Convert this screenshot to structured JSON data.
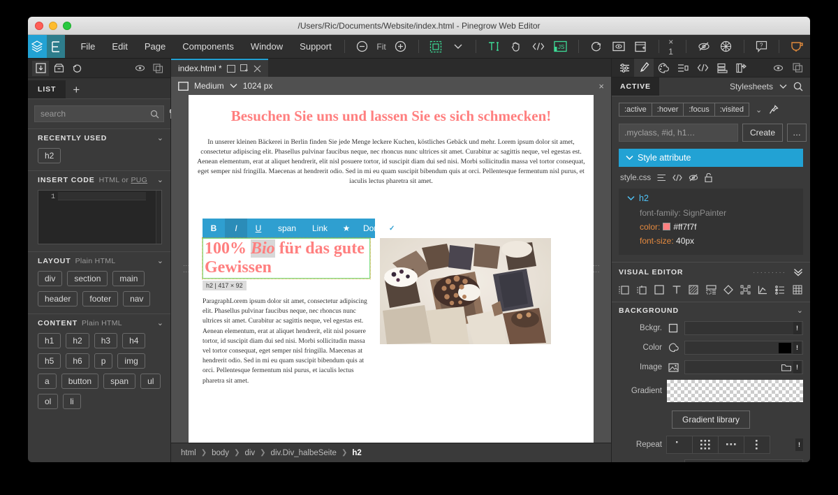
{
  "window": {
    "title": "/Users/Ric/Documents/Website/index.html - Pinegrow Web Editor"
  },
  "menubar": {
    "logo_left": "pinegrow-logo",
    "logo_right": "E",
    "items": [
      "File",
      "Edit",
      "Page",
      "Components",
      "Window",
      "Support"
    ],
    "zoom_fit_label": "Fit",
    "multiplier_label": "× 1"
  },
  "left_panel": {
    "panel_icons": [
      "insert-panel-icon",
      "library-icon",
      "undo-icon",
      "eye-icon",
      "duplicate-icon"
    ],
    "tab_label": "LIST",
    "add_tab_label": "+",
    "search": {
      "placeholder": "search",
      "value": ""
    },
    "sections": [
      {
        "title": "RECENTLY USED",
        "subtitle": "",
        "chips": [
          "h2"
        ]
      },
      {
        "title": "INSERT CODE",
        "subtitle": "HTML or ",
        "subtitle_link": "PUG",
        "code_line_number": "1"
      },
      {
        "title": "LAYOUT",
        "subtitle": "Plain HTML",
        "chips": [
          "div",
          "section",
          "main",
          "header",
          "footer",
          "nav"
        ]
      },
      {
        "title": "CONTENT",
        "subtitle": "Plain HTML",
        "chips": [
          "h1",
          "h2",
          "h3",
          "h4",
          "h5",
          "h6",
          "p",
          "img",
          "a",
          "button",
          "span",
          "ul",
          "ol",
          "li"
        ]
      }
    ]
  },
  "center": {
    "doc_tab": {
      "label": "index.html *",
      "icons": [
        "window-icon",
        "new-window-icon",
        "close-icon"
      ]
    },
    "canvas_bar": {
      "breakpoint_label": "Medium",
      "width_label": "1024 px",
      "close_label": "×"
    },
    "page": {
      "h1": "Besuchen Sie uns und lassen Sie es sich schmecken!",
      "intro": "In unserer kleinen Bäckerei in Berlin finden Sie jede Menge leckere Kuchen, köstliches Gebäck und mehr.  Lorem ipsum dolor sit amet, consectetur adipiscing elit. Phasellus pulvinar faucibus neque, nec rhoncus nunc ultrices sit amet. Curabitur ac sagittis neque, vel egestas est. Aenean elementum, erat at aliquet hendrerit, elit nisl posuere tortor, id suscipit diam dui sed nisi. Morbi sollicitudin massa vel tortor consequat, eget semper nisl fringilla. Maecenas at hendrerit odio. Sed in mi eu quam suscipit bibendum quis at orci. Pellentesque fermentum nisl purus, et iaculis lectus pharetra sit amet.",
      "edit_toolbar": {
        "bold": "B",
        "italic": "I",
        "underline": "U",
        "span": "span",
        "link": "Link",
        "star": "★",
        "done": "Done",
        "done_check": "✓"
      },
      "h2_part1": "100% ",
      "h2_em": "Bio",
      "h2_part2": " für das gute Gewissen",
      "h2_badge": "h2 | 417 × 92",
      "paragraph": "ParagraphLorem ipsum dolor sit amet, consectetur adipiscing elit. Phasellus pulvinar faucibus neque, nec rhoncus nunc ultrices sit amet. Curabitur ac sagittis neque, vel egestas est. Aenean elementum, erat at aliquet hendrerit, elit nisl posuere tortor, id suscipit diam dui sed nisi. Morbi sollicitudin massa vel tortor consequat, eget semper nisl fringilla. Maecenas at hendrerit odio. Sed in mi eu quam suscipit bibendum quis at orci. Pellentesque fermentum nisl purus, et iaculis lectus pharetra sit amet.",
      "image_alt": "muffins-photo"
    },
    "breadcrumb": {
      "items": [
        "html",
        "body",
        "div",
        "div.Div_halbeSeite",
        "h2"
      ],
      "separator": "❯"
    }
  },
  "right_panel": {
    "panel_icons": [
      "sliders-icon",
      "brush-icon",
      "palette-icon",
      "properties-icon",
      "code-icon",
      "layers-icon",
      "components-icon",
      "eye-icon",
      "duplicate-icon"
    ],
    "tab_label": "ACTIVE",
    "stylesheets_label": "Stylesheets",
    "search_icon": "search-icon",
    "pseudo_classes": [
      ":active",
      ":hover",
      ":focus",
      ":visited"
    ],
    "selector_input": {
      "placeholder": ".myclass, #id, h1…",
      "value": ""
    },
    "create_button": "Create",
    "dots_button": "…",
    "style_attribute_label": "Style attribute",
    "css_file": "style.css",
    "css_file_icons": [
      "list-icon",
      "code-icon",
      "eye-off-icon",
      "unlock-icon"
    ],
    "rule": {
      "selector": "h2",
      "declarations": [
        {
          "property": "font-family",
          "value": "SignPainter",
          "muted": true
        },
        {
          "property": "color",
          "value": "#ff7f7f",
          "swatch": "#ff7f7f"
        },
        {
          "property": "font-size",
          "value": "40px"
        }
      ]
    },
    "visual_editor": {
      "title": "VISUAL EDITOR",
      "icons": [
        "margin-icon",
        "padding-icon",
        "box-icon",
        "text-icon",
        "background-icon",
        "layout-icon",
        "effects-icon",
        "transform-icon",
        "transition-icon",
        "list-style-icon",
        "table-icon"
      ]
    },
    "background": {
      "title": "BACKGROUND",
      "rows": [
        {
          "label": "Bckgr.",
          "icon": "square-icon"
        },
        {
          "label": "Color",
          "icon": "palette-icon",
          "swatch": "#000000"
        },
        {
          "label": "Image",
          "icon": "image-icon",
          "folder": "folder-icon"
        },
        {
          "label": "Gradient",
          "icon": ""
        }
      ],
      "gradient_library_button": "Gradient library",
      "repeat_label": "Repeat",
      "bang": "!"
    }
  },
  "colors": {
    "accent_blue": "#22a2d4",
    "panel_bg": "#3a3a3a",
    "dark_bg": "#2b2b2b",
    "canvas_bg": "#505050",
    "heading_pink": "#ff7f7f",
    "selection_green": "#7ee08a"
  }
}
